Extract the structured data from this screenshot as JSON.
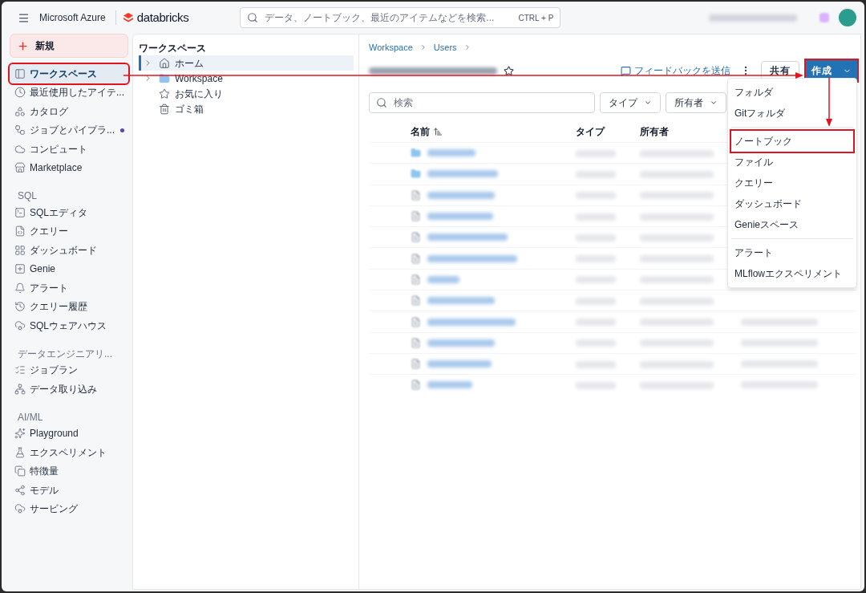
{
  "topbar": {
    "product": "Microsoft Azure",
    "brand": "databricks",
    "search": {
      "placeholder": "データ、ノートブック、最近のアイテムなどを検索...",
      "shortcut": "CTRL + P"
    }
  },
  "sidebar": {
    "new_button": {
      "label": "新規"
    },
    "sections": [
      {
        "items": [
          {
            "label": "ワークスペース",
            "selected": true,
            "highlighted": true,
            "dot": false
          },
          {
            "label": "最近使用したアイテ...",
            "selected": false,
            "highlighted": false,
            "dot": false
          },
          {
            "label": "カタログ",
            "selected": false,
            "highlighted": false,
            "dot": false
          },
          {
            "label": "ジョブとパイプラ...",
            "selected": false,
            "highlighted": false,
            "dot": true
          },
          {
            "label": "コンピュート",
            "selected": false,
            "highlighted": false,
            "dot": false
          },
          {
            "label": "Marketplace",
            "selected": false,
            "highlighted": false,
            "dot": false
          }
        ]
      },
      {
        "heading": "SQL",
        "items": [
          {
            "label": "SQLエディタ",
            "selected": false,
            "highlighted": false,
            "dot": false
          },
          {
            "label": "クエリー",
            "selected": false,
            "highlighted": false,
            "dot": false
          },
          {
            "label": "ダッシュボード",
            "selected": false,
            "highlighted": false,
            "dot": false
          },
          {
            "label": "Genie",
            "selected": false,
            "highlighted": false,
            "dot": false
          },
          {
            "label": "アラート",
            "selected": false,
            "highlighted": false,
            "dot": false
          },
          {
            "label": "クエリー履歴",
            "selected": false,
            "highlighted": false,
            "dot": false
          },
          {
            "label": "SQLウェアハウス",
            "selected": false,
            "highlighted": false,
            "dot": false
          }
        ]
      },
      {
        "heading": "データエンジニアリ...",
        "items": [
          {
            "label": "ジョブラン",
            "selected": false,
            "highlighted": false,
            "dot": false
          },
          {
            "label": "データ取り込み",
            "selected": false,
            "highlighted": false,
            "dot": false
          }
        ]
      },
      {
        "heading": "AI/ML",
        "items": [
          {
            "label": "Playground",
            "selected": false,
            "highlighted": false,
            "dot": false
          },
          {
            "label": "エクスペリメント",
            "selected": false,
            "highlighted": false,
            "dot": false
          },
          {
            "label": "特徴量",
            "selected": false,
            "highlighted": false,
            "dot": false
          },
          {
            "label": "モデル",
            "selected": false,
            "highlighted": false,
            "dot": false
          },
          {
            "label": "サービング",
            "selected": false,
            "highlighted": false,
            "dot": false
          }
        ]
      }
    ]
  },
  "tree": {
    "title": "ワークスペース",
    "items": [
      {
        "label": "ホーム",
        "expandable": true,
        "selected": true
      },
      {
        "label": "Workspace",
        "expandable": true,
        "selected": false
      },
      {
        "label": "お気に入り",
        "expandable": false,
        "selected": false
      },
      {
        "label": "ゴミ箱",
        "expandable": false,
        "selected": false
      }
    ]
  },
  "main": {
    "breadcrumbs": [
      "Workspace",
      "Users"
    ],
    "feedback": "フィードバックを送信",
    "share": "共有",
    "create": {
      "label": "作成",
      "highlighted": true
    },
    "search": {
      "placeholder": "検索"
    },
    "filters": [
      "タイプ",
      "所有者"
    ],
    "columns": [
      "名前",
      "タイプ",
      "所有者"
    ],
    "rows": [
      {
        "kind": "folder"
      },
      {
        "kind": "folder"
      },
      {
        "kind": "file"
      },
      {
        "kind": "file"
      },
      {
        "kind": "file"
      },
      {
        "kind": "file"
      },
      {
        "kind": "file"
      },
      {
        "kind": "file"
      },
      {
        "kind": "file"
      },
      {
        "kind": "file"
      },
      {
        "kind": "file"
      },
      {
        "kind": "file"
      }
    ],
    "menu": {
      "groups": [
        [
          {
            "label": "フォルダ",
            "highlighted": false
          },
          {
            "label": "Gitフォルダ",
            "highlighted": false
          }
        ],
        [
          {
            "label": "ノートブック",
            "highlighted": true
          },
          {
            "label": "ファイル",
            "highlighted": false
          },
          {
            "label": "クエリー",
            "highlighted": false
          },
          {
            "label": "ダッシュボード",
            "highlighted": false
          },
          {
            "label": "Genieスペース",
            "highlighted": false
          }
        ],
        [
          {
            "label": "アラート",
            "highlighted": false
          },
          {
            "label": "MLflowエクスペリメント",
            "highlighted": false
          }
        ]
      ]
    }
  }
}
